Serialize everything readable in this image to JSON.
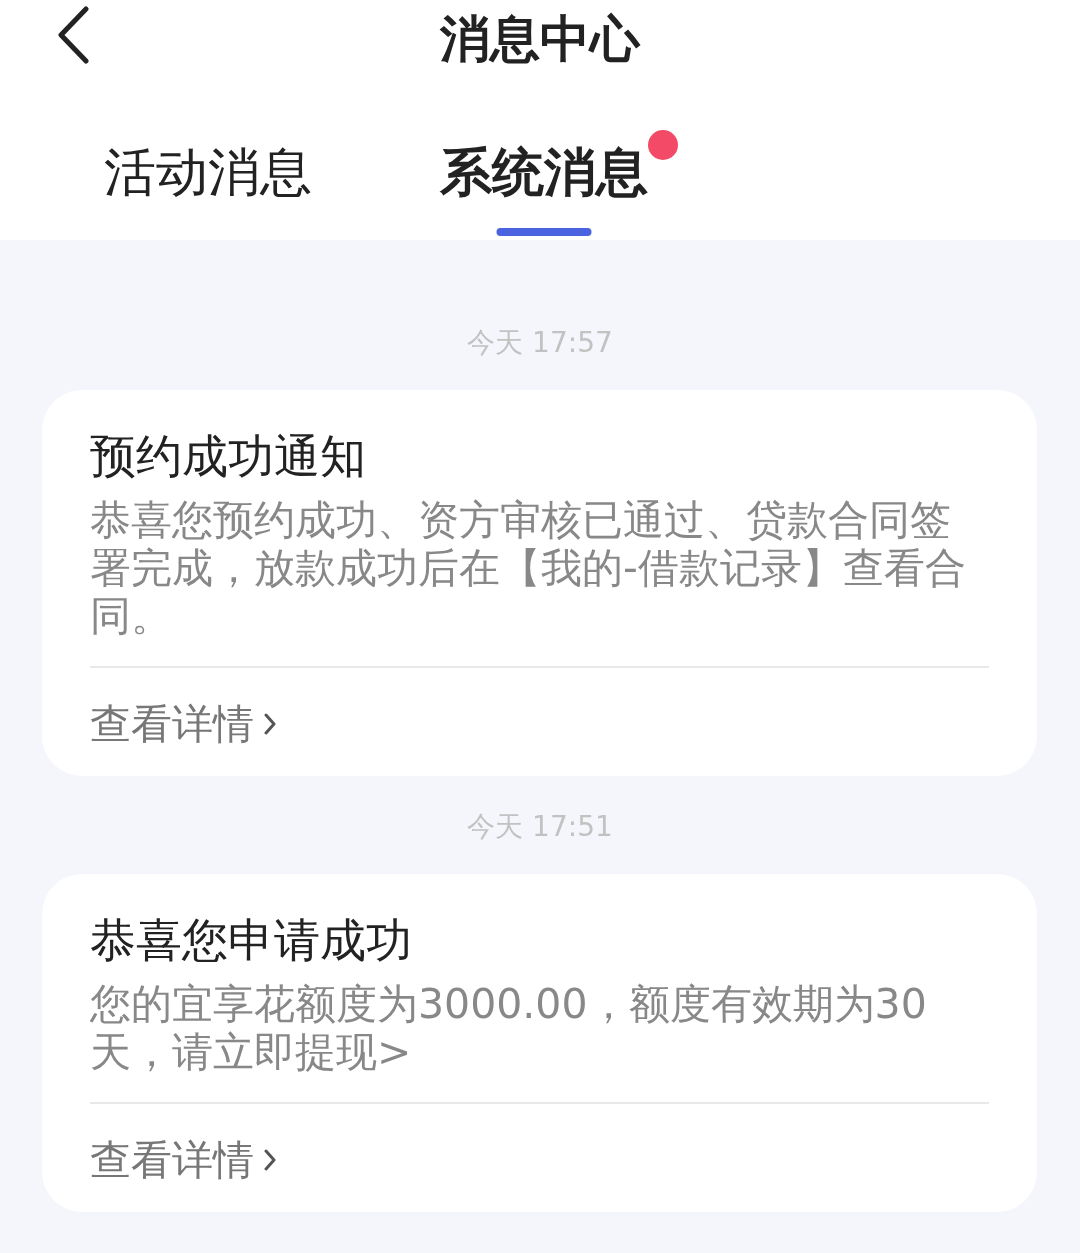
{
  "header": {
    "title": "消息中心"
  },
  "tabs": [
    {
      "label": "活动消息",
      "selected": false,
      "unread": false
    },
    {
      "label": "系统消息",
      "selected": true,
      "unread": true
    }
  ],
  "messages": [
    {
      "time": "今天 17:57",
      "title": "预约成功通知",
      "body": "恭喜您预约成功、资方审核已通过、贷款合同签署完成，放款成功后在【我的-借款记录】查看合同。",
      "link": "查看详情"
    },
    {
      "time": "今天 17:51",
      "title": "恭喜您申请成功",
      "body": "您的宜享花额度为3000.00，额度有效期为30天，请立即提现>",
      "link": "查看详情"
    }
  ]
}
